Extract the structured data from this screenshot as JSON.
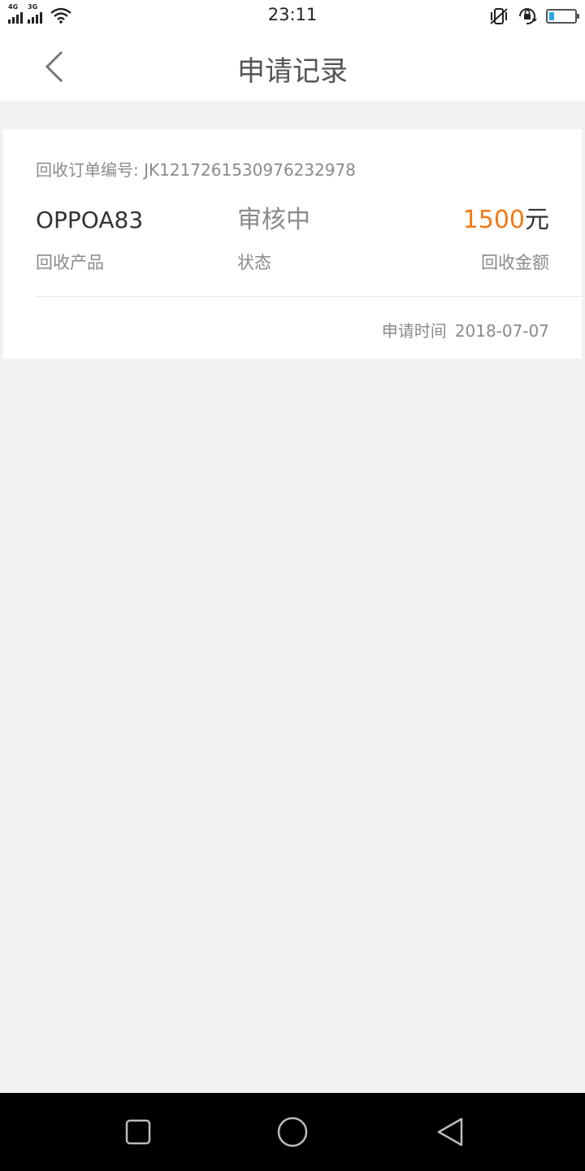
{
  "status_bar": {
    "time": "23:11",
    "network_1": "4G",
    "network_2": "3G",
    "battery_level": 0.2,
    "icons": [
      "signal-4g-icon",
      "signal-3g-icon",
      "wifi-icon",
      "vibrate-icon",
      "rotation-lock-icon",
      "battery-icon"
    ]
  },
  "header": {
    "title": "申请记录",
    "back_icon": "chevron-left-icon"
  },
  "record": {
    "order_label": "回收订单编号:",
    "order_number": "JK1217261530976232978",
    "product_value": "OPPOA83",
    "product_label": "回收产品",
    "status_value": "审核中",
    "status_label": "状态",
    "amount_value": "1500",
    "amount_unit": "元",
    "amount_label": "回收金额",
    "apply_time_label": "申请时间",
    "apply_time_value": "2018-07-07",
    "colors": {
      "amount": "#f07a17",
      "muted": "#8a8a8a",
      "text": "#333333"
    }
  },
  "nav_bar": {
    "icons": [
      "recent-apps-icon",
      "home-icon",
      "back-icon"
    ]
  }
}
